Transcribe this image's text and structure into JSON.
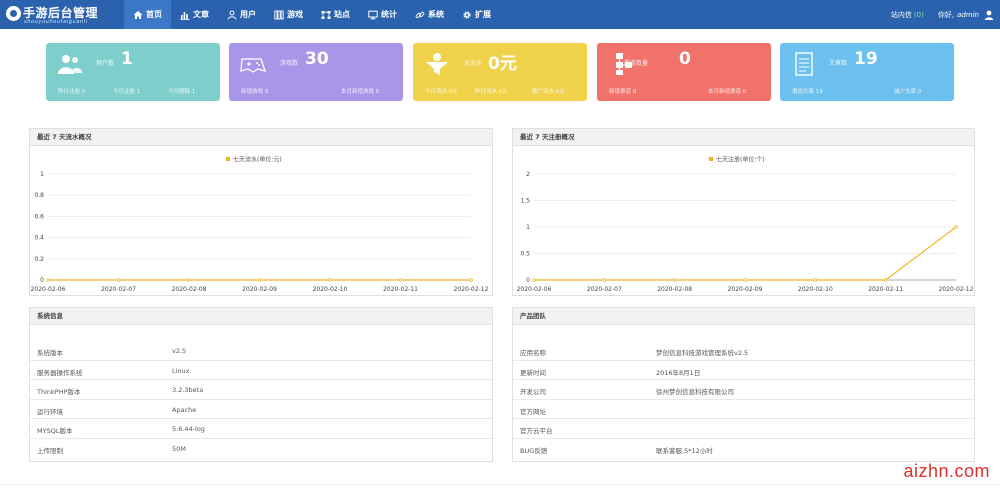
{
  "header": {
    "logo_title": "手游后台管理",
    "logo_sub": "shouyouhoutaiguanli",
    "nav": [
      {
        "label": "首页",
        "icon": "home-icon",
        "active": true
      },
      {
        "label": "文章",
        "icon": "bar-chart-icon",
        "active": false
      },
      {
        "label": "用户",
        "icon": "user-icon",
        "active": false
      },
      {
        "label": "游戏",
        "icon": "columns-icon",
        "active": false
      },
      {
        "label": "站点",
        "icon": "network-icon",
        "active": false
      },
      {
        "label": "统计",
        "icon": "monitor-icon",
        "active": false
      },
      {
        "label": "系统",
        "icon": "link-icon",
        "active": false
      },
      {
        "label": "扩展",
        "icon": "gear-icon",
        "active": false
      }
    ],
    "messages_label": "站内信",
    "messages_count": "(0)",
    "greeting": "你好,",
    "username": "admin"
  },
  "cards": [
    {
      "label": "用户数",
      "value": "1",
      "color": "#7ecfcc",
      "icon": "users-icon",
      "subs": [
        "昨日注册 0",
        "今日注册 1",
        "今日删除 1"
      ]
    },
    {
      "label": "游戏数",
      "value": "30",
      "color": "#a996e8",
      "icon": "gamepad-icon",
      "subs": [
        "新增游戏 0",
        "本月新增游戏 0"
      ]
    },
    {
      "label": "总流水",
      "value": "0元",
      "color": "#efd24a",
      "icon": "funnel-icon",
      "subs": [
        "今日流水 0元",
        "昨日流水 0元",
        "推广流水 0元"
      ]
    },
    {
      "label": "渠道数量",
      "value": "0",
      "color": "#f0726b",
      "icon": "sitemap-icon",
      "subs": [
        "新增渠道 0",
        "本月新增渠道 0"
      ]
    },
    {
      "label": "文章数",
      "value": "19",
      "color": "#6cc0ee",
      "icon": "document-icon",
      "subs": [
        "增加文章 19",
        "减少文章 0"
      ]
    }
  ],
  "charts": [
    {
      "title": "最近 7 天流水概况",
      "chart_data": {
        "type": "line",
        "categories": [
          "2020-02-06",
          "2020-02-07",
          "2020-02-08",
          "2020-02-09",
          "2020-02-10",
          "2020-02-11",
          "2020-02-12"
        ],
        "series": [
          {
            "name": "七天流水(单位:元)",
            "values": [
              0,
              0,
              0,
              0,
              0,
              0,
              0
            ],
            "color": "#f0b429"
          }
        ],
        "yticks": [
          "0",
          "0.2",
          "0.4",
          "0.6",
          "0.8",
          "1"
        ],
        "ylim": [
          0,
          1
        ],
        "legend": "top-center",
        "grid": true
      }
    },
    {
      "title": "最近 7 天注册概况",
      "chart_data": {
        "type": "line",
        "categories": [
          "2020-02-06",
          "2020-02-07",
          "2020-02-08",
          "2020-02-09",
          "2020-02-10",
          "2020-02-11",
          "2020-02-12"
        ],
        "series": [
          {
            "name": "七天注册(单位:个)",
            "values": [
              0,
              0,
              0,
              0,
              0,
              0,
              1
            ],
            "color": "#f0b429"
          }
        ],
        "yticks": [
          "0",
          "0.5",
          "1",
          "1.5",
          "2"
        ],
        "ylim": [
          0,
          2
        ],
        "legend": "top-center",
        "grid": true
      }
    }
  ],
  "system_info": {
    "title": "系统信息",
    "rows": [
      {
        "key": "系统版本",
        "value": "v2.5"
      },
      {
        "key": "服务器操作系统",
        "value": "Linux"
      },
      {
        "key": "ThinkPHP版本",
        "value": "3.2.3beta"
      },
      {
        "key": "运行环境",
        "value": "Apache"
      },
      {
        "key": "MYSQL版本",
        "value": "5.6.44-log"
      },
      {
        "key": "上传限制",
        "value": "50M"
      }
    ]
  },
  "product_team": {
    "title": "产品团队",
    "rows": [
      {
        "key": "应用名称",
        "value": "梦创信息科技游戏管理系统v2.5"
      },
      {
        "key": "更新时间",
        "value": "2016年8月1日"
      },
      {
        "key": "开发公司",
        "value": "徐州梦创信息科技有限公司"
      },
      {
        "key": "官方网址",
        "value": ""
      },
      {
        "key": "官方云平台",
        "value": ""
      },
      {
        "key": "BUG反馈",
        "value": "联系客服,5*12小时"
      }
    ]
  },
  "watermark": "aizhn.com"
}
